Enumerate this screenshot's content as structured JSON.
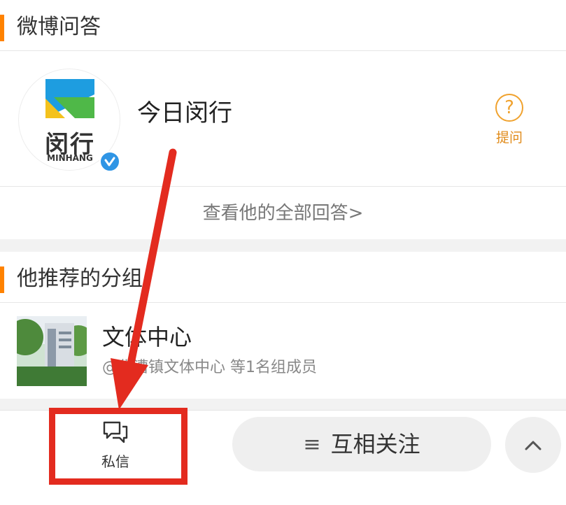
{
  "qa_section": {
    "title": "微博问答",
    "profile_name": "今日闵行",
    "avatar_logo_text": "闵行",
    "avatar_sub_text": "MINHANG",
    "ask_label": "提问",
    "view_all": "查看他的全部回答>"
  },
  "groups_section": {
    "title": "他推荐的分组",
    "group_name": "文体中心",
    "group_meta": "@华漕镇文体中心 等1名组成员"
  },
  "bottom_bar": {
    "message_label": "私信",
    "follow_label": "互相关注",
    "follow_icon": "menu-icon",
    "up_icon": "chevron-up-icon"
  },
  "colors": {
    "accent": "#ff8200",
    "annotation_red": "#e32b1f",
    "verified_blue": "#2f95e5"
  }
}
